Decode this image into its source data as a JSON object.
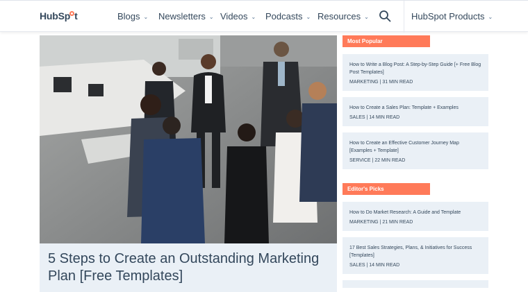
{
  "header": {
    "logo_text_a": "HubSp",
    "logo_text_b": "t",
    "nav": [
      {
        "label": "Blogs"
      },
      {
        "label": "Newsletters"
      },
      {
        "label": "Videos"
      },
      {
        "label": "Podcasts"
      },
      {
        "label": "Resources"
      }
    ],
    "products_label": "HubSpot Products",
    "search_icon": "search-icon"
  },
  "hero": {
    "image": "team-meeting-photo",
    "title": "5 Steps to Create an Outstanding Marketing Plan [Free Templates]"
  },
  "sidebar": {
    "most_popular": {
      "label": "Most Popular",
      "items": [
        {
          "title": "How to Write a Blog Post: A Step-by-Step Guide [+ Free Blog Post Templates]",
          "meta": "MARKETING | 31 MIN READ"
        },
        {
          "title": "How to Create a Sales Plan: Template + Examples",
          "meta": "SALES | 14 MIN READ"
        },
        {
          "title": "How to Create an Effective Customer Journey Map [Examples + Template]",
          "meta": "SERVICE | 22 MIN READ"
        }
      ]
    },
    "editors_picks": {
      "label": "Editor's Picks",
      "items": [
        {
          "title": "How to Do Market Research: A Guide and Template",
          "meta": "MARKETING | 21 MIN READ"
        },
        {
          "title": "17 Best Sales Strategies, Plans, & Initiatives for Success [Templates]",
          "meta": "SALES | 14 MIN READ"
        }
      ]
    }
  },
  "colors": {
    "accent": "#ff7a59",
    "text": "#33475b",
    "card_bg": "#eaf0f6"
  }
}
